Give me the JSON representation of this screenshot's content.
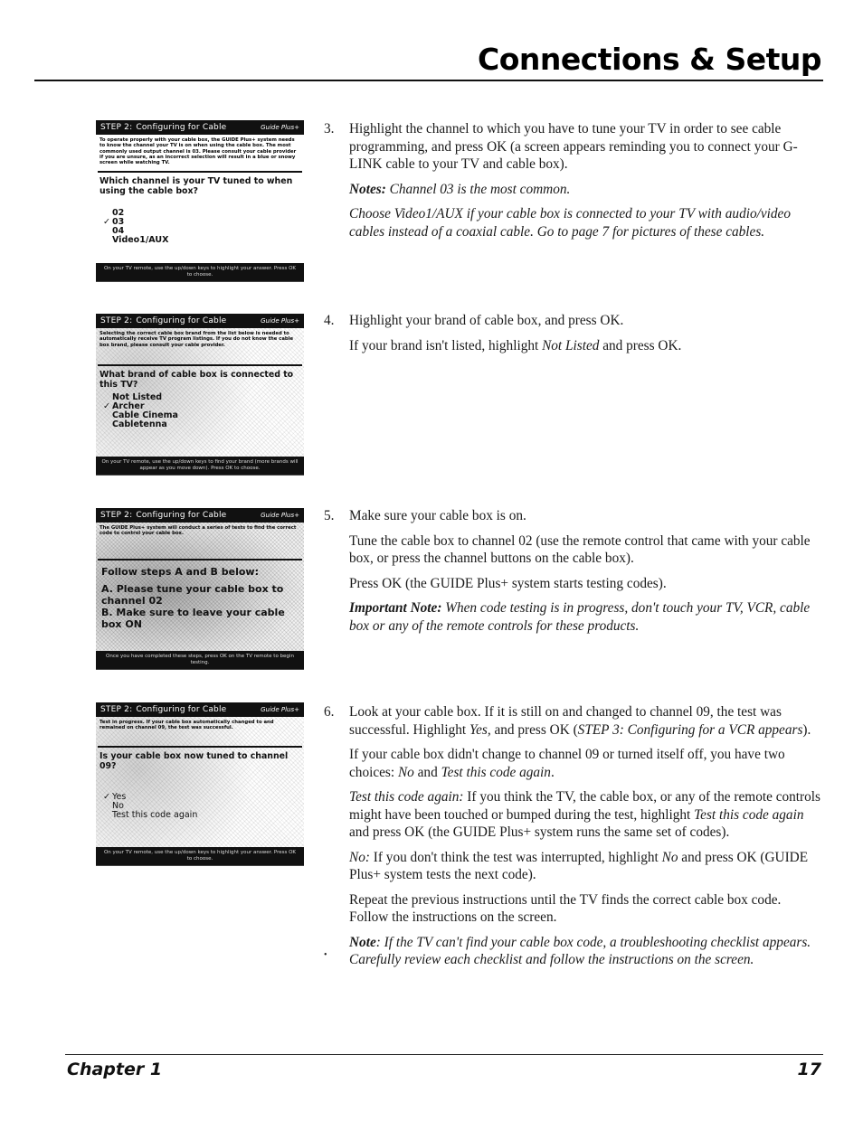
{
  "header": {
    "title": "Connections & Setup"
  },
  "footer": {
    "chapter": "Chapter 1",
    "page": "17"
  },
  "screens": [
    {
      "step": "STEP 2:",
      "title": "Configuring for Cable",
      "logo": "Guide Plus+",
      "info": "To operate properly with your cable box, the GUIDE Plus+ system needs to know the channel your TV is on when using the cable box. The most commonly used output channel is 03. Please consult your cable provider if you are unsure, as an incorrect selection will result in a blue or snowy screen while watching TV.",
      "question": "Which channel is your TV tuned to when using the cable box?",
      "options": [
        "02",
        "03",
        "04",
        "Video1/AUX"
      ],
      "selected_index": 1,
      "footer": "On your TV remote, use the up/down keys to highlight your answer. Press OK to choose."
    },
    {
      "step": "STEP 2:",
      "title": "Configuring for Cable",
      "logo": "Guide Plus+",
      "info": "Selecting the correct cable box brand from the list below is needed to automatically receive TV program listings. If you do not know the cable box brand, please consult your cable provider.",
      "question": "What brand of cable box is connected to this TV?",
      "options": [
        "Not Listed",
        "Archer",
        "Cable Cinema",
        "Cabletenna"
      ],
      "selected_index": 1,
      "footer": "On your TV remote, use the up/down keys to find your brand (more brands will appear as you move down). Press OK to choose."
    },
    {
      "step": "STEP 2:",
      "title": "Configuring for Cable",
      "logo": "Guide Plus+",
      "info": "The GUIDE Plus+ system will conduct a series of tests to find the correct code to control your cable box.",
      "lines": [
        "Follow steps A and B below:",
        "A. Please tune your cable box to channel 02",
        "B. Make sure to leave your cable box ON"
      ],
      "footer": "Once you have completed these steps, press OK on the TV remote to begin testing."
    },
    {
      "step": "STEP 2:",
      "title": "Configuring for Cable",
      "logo": "Guide Plus+",
      "info": "Test in progress. If your cable box automatically changed to and remained on channel 09, the test was successful.",
      "question": "Is your cable box now tuned to channel 09?",
      "options": [
        "Yes",
        "No",
        "Test this code again"
      ],
      "selected_index": 0,
      "footer": "On your TV remote, use the up/down keys to highlight your answer. Press OK to choose."
    }
  ],
  "steps": {
    "s3": {
      "num": "3.",
      "p1": "Highlight the channel to which you have to tune your TV in order to see cable programming, and press OK (a screen appears reminding you to connect your G-LINK cable to your TV and cable box).",
      "notes_label": "Notes:",
      "notes_text": " Channel 03 is the most common.",
      "p3": "Choose Video1/AUX if your cable box is connected to your TV with audio/video cables instead of a coaxial cable. Go to page 7 for pictures of these cables."
    },
    "s4": {
      "num": "4.",
      "p1": "Highlight your brand of cable box, and press OK.",
      "p2a": "If your brand isn't listed, highlight ",
      "p2b": "Not Listed",
      "p2c": " and press OK."
    },
    "s5": {
      "num": "5.",
      "p1": "Make sure your cable box is on.",
      "p2": "Tune the cable box to channel 02 (use the remote control that came with your cable box, or press the channel buttons on the cable box).",
      "p3": "Press OK (the GUIDE Plus+ system starts testing codes).",
      "note_label": "Important Note:",
      "note_text": " When code testing is in progress, don't touch your TV, VCR, cable box or any of the remote controls for these products."
    },
    "s6": {
      "num": "6.",
      "p1a": "Look at your cable box. If it is still on and changed to channel 09, the test was successful. Highlight ",
      "p1b": "Yes,",
      "p1c": " and press OK (",
      "p1d": "STEP 3: Configuring for a VCR appears",
      "p1e": ").",
      "p2a": "If your cable box didn't change to channel 09 or turned itself off, you have two choices: ",
      "p2b": "No",
      "p2c": " and ",
      "p2d": "Test this code again",
      "p2e": ".",
      "p3a": "Test this code again:",
      "p3b": " If you think the TV, the cable box, or any of the remote controls might have been touched or bumped during the test, highlight ",
      "p3c": "Test this code again",
      "p3d": " and press OK (the GUIDE Plus+ system runs the same set of codes).",
      "p4a": "No:",
      "p4b": " If you don't think the test was interrupted, highlight ",
      "p4c": "No",
      "p4d": " and press OK (GUIDE Plus+ system tests the next code).",
      "p5": "Repeat the previous instructions until the TV finds the correct cable box code. Follow the instructions on the screen.",
      "note_label": "Note",
      "note_text": ": If the TV can't find your cable box code, a troubleshooting checklist appears. Carefully review each checklist and follow the instructions on the screen."
    }
  }
}
